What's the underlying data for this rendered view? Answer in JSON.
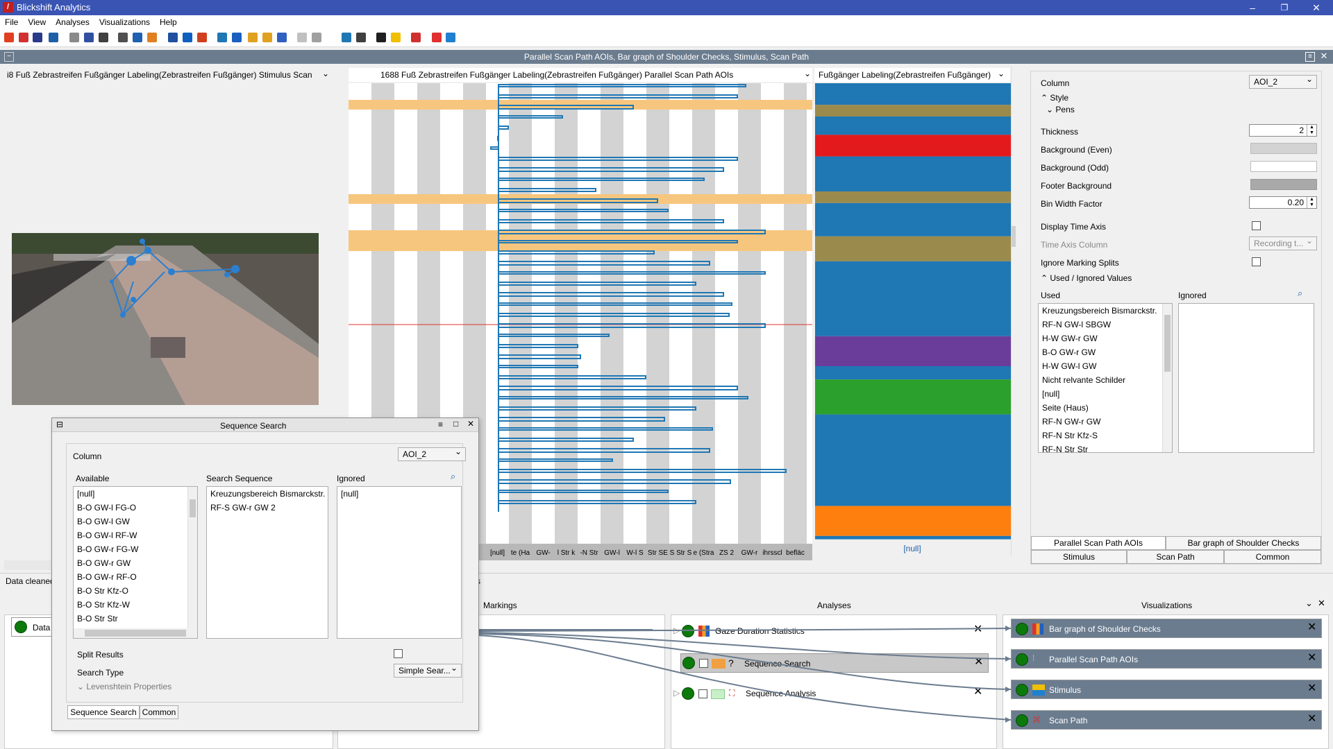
{
  "window": {
    "title": "Blickshift Analytics",
    "logo": "/",
    "controls": [
      "–",
      "❐",
      "✕"
    ]
  },
  "menu": [
    "File",
    "View",
    "Analyses",
    "Visualizations",
    "Help"
  ],
  "panel": {
    "title": "Parallel Scan Path AOIs, Bar graph of Shoulder Checks, Stimulus, Scan Path"
  },
  "stimulus": {
    "header": "i8 Fuß  Zebrastreifen Fußgänger Labeling(Zebrastreifen Fußgänger) Stimulus Scan"
  },
  "parallel": {
    "header": "1688 Fuß  Zebrastreifen Fußgänger Labeling(Zebrastreifen Fußgänger) Parallel Scan Path AOIs",
    "axis_labels": [
      "te",
      "[null]",
      "te (Ha",
      "GW-",
      "l Str k",
      "-N Str",
      "GW-l",
      "W-l S",
      "Str SE",
      "S Str S",
      "e (Stra",
      "ZS 2",
      "GW-r",
      "ihrsscl",
      "befläc"
    ]
  },
  "bargraph": {
    "header": "Fußgänger Labeling(Zebrastreifen Fußgänger)",
    "footer": "[null]"
  },
  "colors": {
    "blue": "#1f77b4",
    "olive": "#9a8a4c",
    "red": "#e31a1c",
    "purple": "#6a3d9a",
    "green": "#2ca02c",
    "orange": "#ff7f0e",
    "highlight": "#f7c67e"
  },
  "props": {
    "column_label": "Column",
    "column_value": "AOI_2",
    "style_label": "Style",
    "pens_label": "Pens",
    "thickness_label": "Thickness",
    "thickness_value": "2",
    "bg_even_label": "Background (Even)",
    "bg_odd_label": "Background (Odd)",
    "footer_bg_label": "Footer Background",
    "bin_width_label": "Bin Width Factor",
    "bin_width_value": "0.20",
    "time_axis_label": "Display Time Axis",
    "time_axis_col_label": "Time Axis Column",
    "time_axis_col_value": "Recording t...",
    "ignore_marking_label": "Ignore Marking Splits",
    "used_ignored_label": "Used / Ignored Values",
    "used_label": "Used",
    "ignored_label": "Ignored",
    "used": [
      "Kreuzungsbereich Bismarckstr.",
      "RF-N GW-l SBGW",
      "H-W GW-r GW",
      "B-O GW-r GW",
      "H-W GW-l GW",
      "Nicht relvante Schilder",
      "[null]",
      "Seite (Haus)",
      "RF-N GW-r GW",
      "RF-N Str Kfz-S",
      "RF-N Str Str"
    ],
    "tabs_row1": [
      "Parallel Scan Path AOIs",
      "Bar graph of Shoulder Checks"
    ],
    "tabs_row2": [
      "Stimulus",
      "Scan Path",
      "Common"
    ]
  },
  "status": {
    "text": "Data cleaned",
    "text2": "s"
  },
  "sequence_search": {
    "title": "Sequence Search",
    "column_label": "Column",
    "column_value": "AOI_2",
    "available_label": "Available",
    "search_label": "Search Sequence",
    "ignored_label": "Ignored",
    "available": [
      "[null]",
      "B-O GW-l FG-O",
      "B-O GW-l GW",
      "B-O GW-l RF-W",
      "B-O GW-r FG-W",
      "B-O GW-r GW",
      "B-O GW-r RF-O",
      "B-O Str Kfz-O",
      "B-O Str Kfz-W",
      "B-O Str Str"
    ],
    "search": [
      "Kreuzungsbereich Bismarckstr.",
      "RF-S GW-r GW 2"
    ],
    "ignored": [
      "[null]"
    ],
    "split_label": "Split Results",
    "search_type_label": "Search Type",
    "search_type_value": "Simple Sear...",
    "levenshtein_label": "Levenshtein Properties",
    "tabs": [
      "Sequence Search",
      "Common"
    ]
  },
  "workflow": {
    "markings_label": "Markings",
    "analyses_label": "Analyses",
    "visualizations_label": "Visualizations",
    "data_label": "Data",
    "analyses": [
      "Gaze Duration Statistics",
      "Sequence Search",
      "Sequence Analysis"
    ],
    "visualizations": [
      "Bar graph of Shoulder Checks",
      "Parallel Scan Path AOIs",
      "Stimulus",
      "Scan Path"
    ]
  }
}
